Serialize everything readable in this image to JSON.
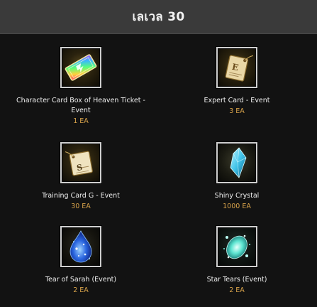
{
  "header": {
    "title": "เลเวล 30"
  },
  "rewards": [
    {
      "name": "Character Card Box of Heaven Ticket - Event",
      "qty": "1 EA",
      "icon": "rainbow-ticket-icon"
    },
    {
      "name": "Expert Card - Event",
      "qty": "3 EA",
      "icon": "expert-card-icon"
    },
    {
      "name": "Training Card G - Event",
      "qty": "30 EA",
      "icon": "training-card-icon"
    },
    {
      "name": "Shiny Crystal",
      "qty": "1000 EA",
      "icon": "shiny-crystal-icon"
    },
    {
      "name": "Tear of Sarah (Event)",
      "qty": "2 EA",
      "icon": "blue-tear-icon"
    },
    {
      "name": "Star Tears (Event)",
      "qty": "2 EA",
      "icon": "star-tears-icon"
    }
  ]
}
